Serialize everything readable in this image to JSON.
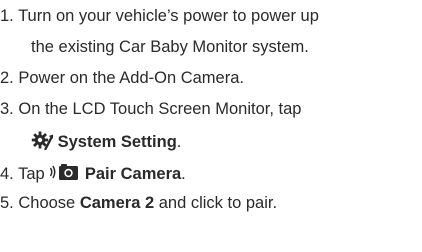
{
  "steps": [
    {
      "number": "1.",
      "line1": "Turn on your vehicle’s power to power up",
      "line2": "the existing Car Baby Monitor system."
    },
    {
      "number": "2.",
      "text": "Power on the Add-On Camera."
    },
    {
      "number": "3.",
      "line1": "On the LCD Touch Screen Monitor, tap",
      "label": "System Setting",
      "suffix": ".",
      "icon": "gear-wrench-icon"
    },
    {
      "number": "4.",
      "prefix": "Tap",
      "label": "Pair Camera",
      "suffix": ".",
      "icon": "camera-pair-icon"
    },
    {
      "number": "5.",
      "prefix": "Choose",
      "label": "Camera 2",
      "suffix": "and click to pair."
    }
  ]
}
